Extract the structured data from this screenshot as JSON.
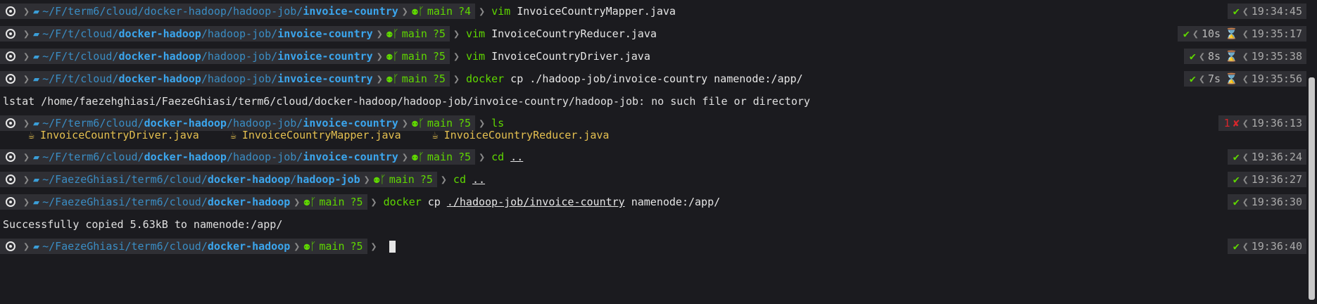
{
  "window": {
    "title": "Terminal"
  },
  "colors": {
    "background": "#1b1b1f",
    "command_green": "#5fd700",
    "path_blue": "#3ba6ee",
    "java_yellow": "#e5c050",
    "error_red": "#d7262c"
  },
  "lines": [
    {
      "path_dim": "~/F/term6/cloud/docker-hadoop/hadoop-job/",
      "path_bold": "invoice-country",
      "git_branch": "main",
      "git_status": "?4",
      "command": "vim",
      "args": "InvoiceCountryMapper.java",
      "status_icon": "✔",
      "duration": "",
      "time": "19:34:45"
    },
    {
      "path_dim": "~/F/t/cloud/",
      "path_mid": "docker-hadoop",
      "path_dim2": "/hadoop-job/",
      "path_bold": "invoice-country",
      "git_branch": "main",
      "git_status": "?5",
      "command": "vim",
      "args": "InvoiceCountryReducer.java",
      "status_icon": "✔",
      "duration": "10s",
      "time": "19:35:17"
    },
    {
      "path_dim": "~/F/t/cloud/",
      "path_mid": "docker-hadoop",
      "path_dim2": "/hadoop-job/",
      "path_bold": "invoice-country",
      "git_branch": "main",
      "git_status": "?5",
      "command": "vim",
      "args": "InvoiceCountryDriver.java",
      "status_icon": "✔",
      "duration": "8s",
      "time": "19:35:38"
    },
    {
      "path_dim": "~/F/t/cloud/",
      "path_mid": "docker-hadoop",
      "path_dim2": "/hadoop-job/",
      "path_bold": "invoice-country",
      "git_branch": "main",
      "git_status": "?5",
      "command": "docker",
      "args": "cp ./hadoop-job/invoice-country namenode:/app/",
      "status_icon": "✔",
      "duration": "7s",
      "time": "19:35:56"
    },
    {
      "output": "lstat /home/faezehghiasi/FaezeGhiasi/term6/cloud/docker-hadoop/hadoop-job/invoice-country/hadoop-job: no such file or directory"
    },
    {
      "path_dim": "~/F/term6/cloud/",
      "path_mid": "docker-hadoop",
      "path_dim2": "/hadoop-job/",
      "path_bold": "invoice-country",
      "git_branch": "main",
      "git_status": "?5",
      "command": "ls",
      "args": "",
      "status_code": "1",
      "status_icon": "✘",
      "duration": "",
      "time": "19:36:13"
    },
    {
      "files": [
        "InvoiceCountryDriver.java",
        "InvoiceCountryMapper.java",
        "InvoiceCountryReducer.java"
      ]
    },
    {
      "path_dim": "~/F/term6/cloud/",
      "path_mid": "docker-hadoop",
      "path_dim2": "/hadoop-job/",
      "path_bold": "invoice-country",
      "git_branch": "main",
      "git_status": "?5",
      "command": "cd",
      "args": "..",
      "status_icon": "✔",
      "duration": "",
      "time": "19:36:24"
    },
    {
      "path_dim": "~/FaezeGhiasi/term6/cloud/",
      "path_mid": "docker-hadoop",
      "path_dim2": "/",
      "path_bold": "hadoop-job",
      "git_branch": "main",
      "git_status": "?5",
      "command": "cd",
      "args": "..",
      "status_icon": "✔",
      "duration": "",
      "time": "19:36:27"
    },
    {
      "path_dim": "~/FaezeGhiasi/term6/cloud/",
      "path_bold": "docker-hadoop",
      "git_branch": "main",
      "git_status": "?5",
      "command": "docker",
      "args_a": "cp",
      "args_b": "./hadoop-job/invoice-country",
      "args_c": "namenode:/app/",
      "status_icon": "✔",
      "duration": "",
      "time": "19:36:30"
    },
    {
      "output": "Successfully copied 5.63kB to namenode:/app/"
    },
    {
      "path_dim": "~/FaezeGhiasi/term6/cloud/",
      "path_bold": "docker-hadoop",
      "git_branch": "main",
      "git_status": "?5",
      "status_icon": "✔",
      "duration": "",
      "time": "19:36:40"
    }
  ],
  "icons": {
    "os": "linux-os-icon",
    "folder": "folder-icon",
    "git": "github-icon",
    "branch": "git-branch-icon",
    "java": "java-cup-icon",
    "hourglass": "hourglass-icon"
  }
}
